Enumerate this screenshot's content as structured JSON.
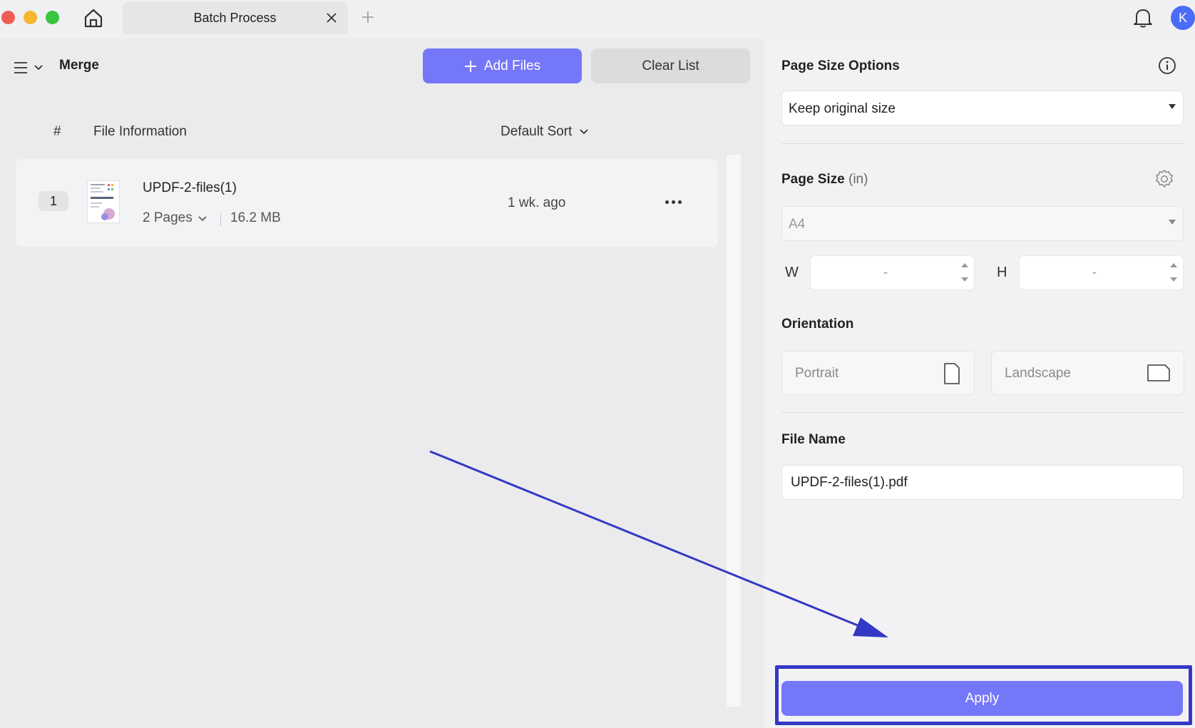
{
  "window": {
    "tab_title": "Batch Process",
    "avatar_initial": "K"
  },
  "toolbar": {
    "mode_title": "Merge",
    "add_files_label": "Add Files",
    "clear_list_label": "Clear List"
  },
  "file_list": {
    "columns": {
      "index": "#",
      "info": "File Information",
      "sort": "Default Sort"
    },
    "rows": [
      {
        "index": "1",
        "name": "UPDF-2-files(1)",
        "pages": "2 Pages",
        "size": "16.2 MB",
        "modified": "1 wk. ago"
      }
    ]
  },
  "settings": {
    "page_size_options_title": "Page Size Options",
    "page_size_options_value": "Keep original size",
    "page_size_title": "Page Size",
    "page_size_unit": "(in)",
    "page_size_value": "A4",
    "width_label": "W",
    "width_value": "-",
    "height_label": "H",
    "height_value": "-",
    "orientation_title": "Orientation",
    "portrait_label": "Portrait",
    "landscape_label": "Landscape",
    "file_name_title": "File Name",
    "file_name_value": "UPDF-2-files(1).pdf",
    "apply_label": "Apply"
  },
  "colors": {
    "accent": "#7577f9",
    "annotation": "#3438c4"
  }
}
